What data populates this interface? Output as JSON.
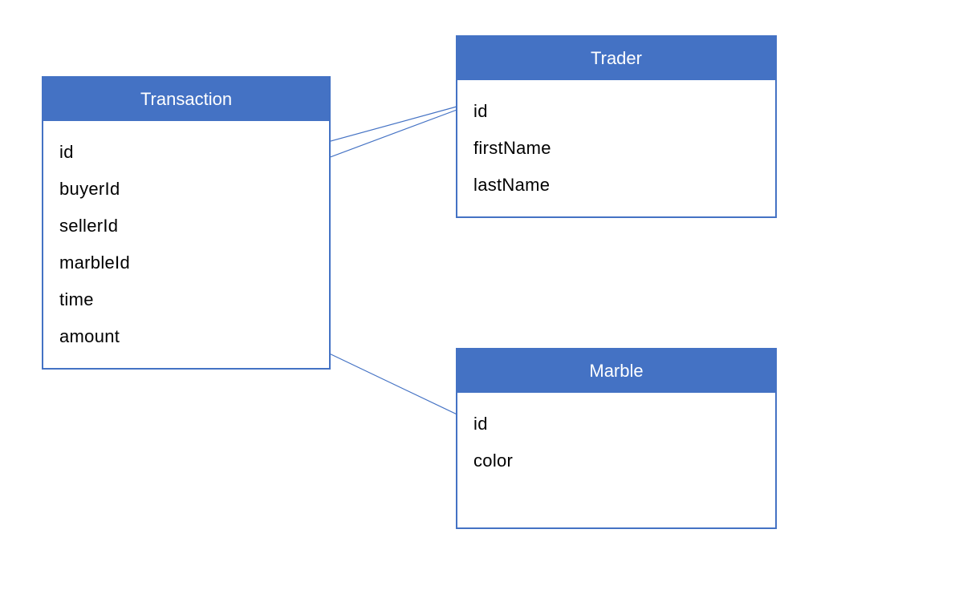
{
  "entities": {
    "transaction": {
      "title": "Transaction",
      "fields": {
        "f0": "id",
        "f1": "buyerId",
        "f2": "sellerId",
        "f3": "marbleId",
        "f4": "time",
        "f5": "amount"
      }
    },
    "trader": {
      "title": "Trader",
      "fields": {
        "f0": "id",
        "f1": "firstName",
        "f2": "lastName"
      }
    },
    "marble": {
      "title": "Marble",
      "fields": {
        "f0": "id",
        "f1": "color"
      }
    }
  },
  "relationships": [
    {
      "from": "transaction.buyerId",
      "to": "trader.id"
    },
    {
      "from": "transaction.sellerId",
      "to": "trader.id"
    },
    {
      "from": "transaction.marbleId",
      "to": "marble.id"
    }
  ],
  "colors": {
    "headerBg": "#4472c4",
    "border": "#4472c4",
    "arrow": "#4472c4"
  }
}
